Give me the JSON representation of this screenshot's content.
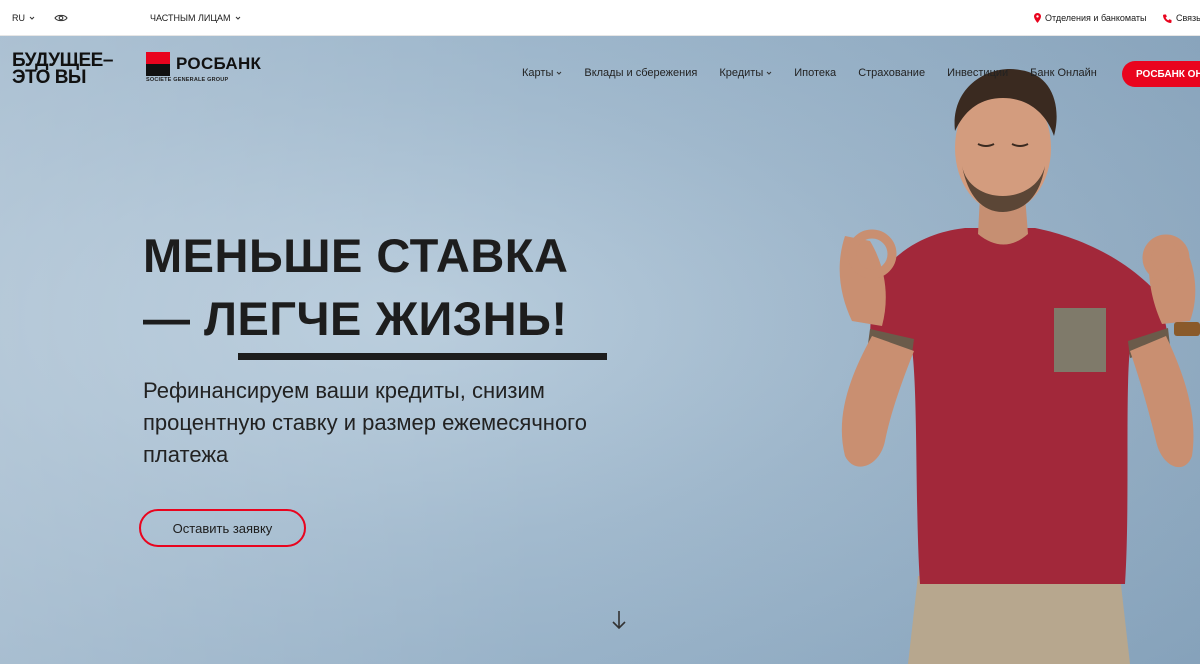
{
  "topbar": {
    "lang": "RU",
    "segment": "ЧАСТНЫМ ЛИЦАМ",
    "branches": "Отделения и банкоматы",
    "contact": "Связь"
  },
  "logo": {
    "slogan_line1": "БУДУЩЕЕ–",
    "slogan_line2": "ЭТО ВЫ",
    "brand": "РОСБАНК",
    "brand_sub": "SOCIETE GENERALE GROUP"
  },
  "nav": {
    "items": [
      {
        "label": "Карты",
        "dropdown": true
      },
      {
        "label": "Вклады и сбережения",
        "dropdown": false
      },
      {
        "label": "Кредиты",
        "dropdown": true
      },
      {
        "label": "Ипотека",
        "dropdown": false
      },
      {
        "label": "Страхование",
        "dropdown": false
      },
      {
        "label": "Инвестиции",
        "dropdown": false
      },
      {
        "label": "Банк Онлайн",
        "dropdown": false
      }
    ],
    "cta": "РОСБАНК ОНЛАЙН"
  },
  "hero": {
    "headline_line1": "МЕНЬШЕ СТАВКА",
    "headline_line2": "— ЛЕГЧЕ ЖИЗНЬ!",
    "subtitle": "Рефинансируем ваши кредиты, снизим процентную ставку и размер ежемесячного платежа",
    "button": "Оставить заявку"
  },
  "colors": {
    "accent": "#e9041e",
    "text": "#1d1d1d",
    "hero_bg": "#a2bace"
  }
}
